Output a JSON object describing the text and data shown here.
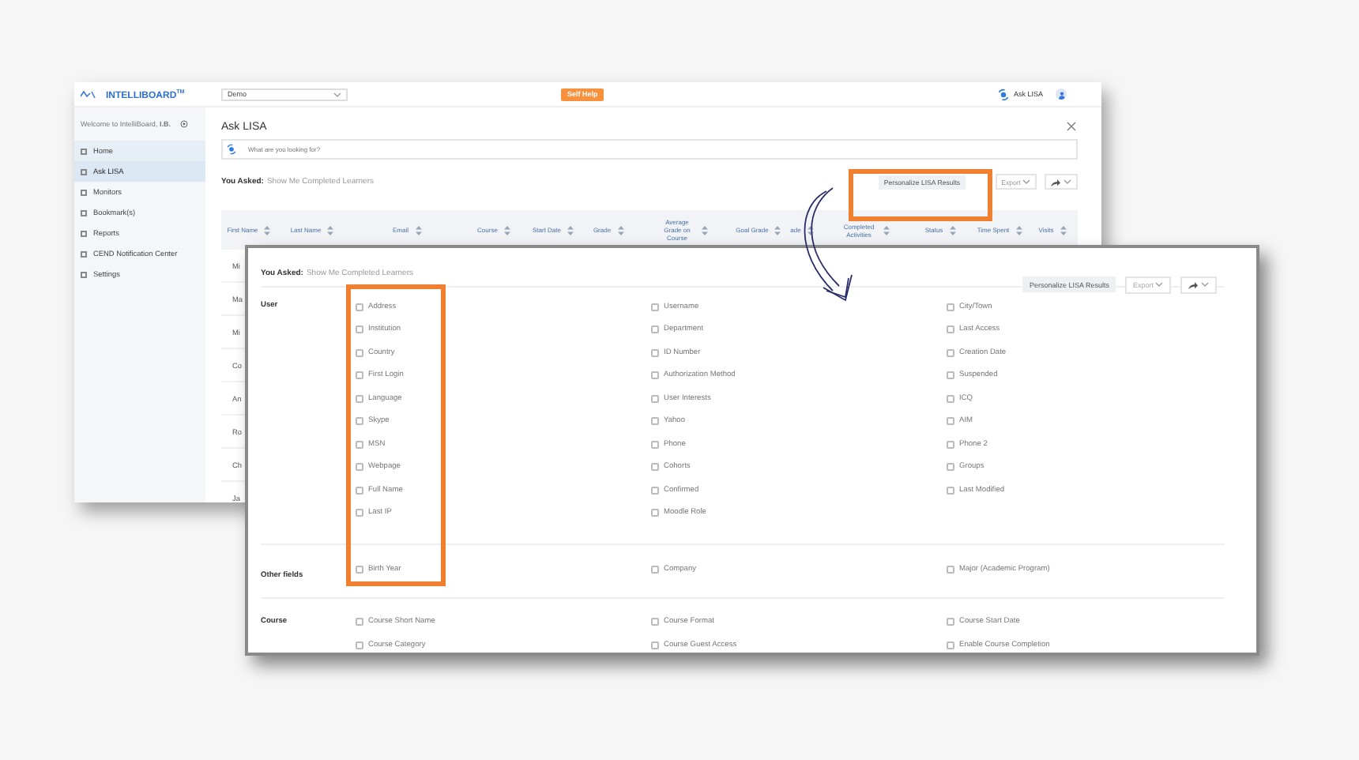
{
  "back_window": {
    "logo": "INTELLIBOARD$^{TM}$",
    "org_select": "Demo",
    "help_button": "Self Help",
    "assistant_link": "Ask LISA",
    "welcome": "Welcome to IntelliBoard, **I.B.**",
    "nav": [
      {
        "label": "Home",
        "selected": false,
        "hovered": true
      },
      {
        "label": "Ask LISA",
        "selected": true,
        "hovered": false
      },
      {
        "label": "Monitors",
        "selected": false,
        "hovered": false
      },
      {
        "label": "Bookmark(s)",
        "selected": false,
        "hovered": false
      },
      {
        "label": "Reports",
        "selected": false,
        "hovered": false
      },
      {
        "label": "CEND Notification Center",
        "selected": false,
        "hovered": false
      },
      {
        "label": "Settings",
        "selected": false,
        "hovered": false
      }
    ],
    "title": "Ask LISA",
    "search": {
      "placeholder": "What are you looking for?"
    },
    "asked_label": "You Asked:",
    "asked_query": "Show Me Completed Learners",
    "personalize_button": "Personalize LISA Results",
    "export_button": "Export",
    "table": {
      "columns": [
        "First Name",
        "Last Name",
        "Email",
        "Course",
        "Start Date",
        "Grade",
        "Average Grade on Course",
        "Goal Grade",
        "ade",
        "Completed Activities",
        "Status",
        "Time Spent",
        "Visits"
      ],
      "rows": [
        "Mi",
        "Ma",
        "Mi",
        "Co",
        "An",
        "Ro",
        "Ch",
        "Ja"
      ]
    }
  },
  "front_window": {
    "asked_label": "You Asked:",
    "asked_query": "Show Me Completed Learners",
    "personalize_button": "Personalize LISA Results",
    "export_button": "Export",
    "sections": [
      {
        "title": "User",
        "columns": [
          [
            {
              "label": "Address",
              "checked": false
            },
            {
              "label": "Institution",
              "checked": false
            },
            {
              "label": "Country",
              "checked": false
            },
            {
              "label": "First Login",
              "checked": false
            },
            {
              "label": "Language",
              "checked": false
            },
            {
              "label": "Skype",
              "checked": false
            },
            {
              "label": "MSN",
              "checked": false
            },
            {
              "label": "Webpage",
              "checked": false
            },
            {
              "label": "Full Name",
              "checked": false
            },
            {
              "label": "Last IP",
              "checked": false
            }
          ],
          [
            {
              "label": "Username",
              "checked": false
            },
            {
              "label": "Department",
              "checked": false
            },
            {
              "label": "ID Number",
              "checked": false
            },
            {
              "label": "Authorization Method",
              "checked": false
            },
            {
              "label": "User Interests",
              "checked": false
            },
            {
              "label": "Yahoo",
              "checked": false
            },
            {
              "label": "Phone",
              "checked": false
            },
            {
              "label": "Cohorts",
              "checked": false
            },
            {
              "label": "Confirmed",
              "checked": false
            },
            {
              "label": "Moodle Role",
              "checked": false
            }
          ],
          [
            {
              "label": "City/Town",
              "checked": false
            },
            {
              "label": "Last Access",
              "checked": false
            },
            {
              "label": "Creation Date",
              "checked": false
            },
            {
              "label": "Suspended",
              "checked": false
            },
            {
              "label": "ICQ",
              "checked": false
            },
            {
              "label": "AIM",
              "checked": false
            },
            {
              "label": "Phone 2",
              "checked": false
            },
            {
              "label": "Groups",
              "checked": false
            },
            {
              "label": "Last Modified",
              "checked": false
            }
          ]
        ]
      },
      {
        "title": "Other fields",
        "columns": [
          [
            {
              "label": "Birth Year",
              "checked": false
            }
          ],
          [
            {
              "label": "Company",
              "checked": false
            }
          ],
          [
            {
              "label": "Major (Academic Program)",
              "checked": false
            }
          ]
        ]
      },
      {
        "title": "Course",
        "columns": [
          [
            {
              "label": "Course Short Name",
              "checked": false
            },
            {
              "label": "Course Category",
              "checked": false
            }
          ],
          [
            {
              "label": "Course Format",
              "checked": false
            },
            {
              "label": "Course Guest Access",
              "checked": false
            }
          ],
          [
            {
              "label": "Course Start Date",
              "checked": false
            },
            {
              "label": "Enable Course Completion",
              "checked": false
            }
          ]
        ]
      }
    ]
  }
}
